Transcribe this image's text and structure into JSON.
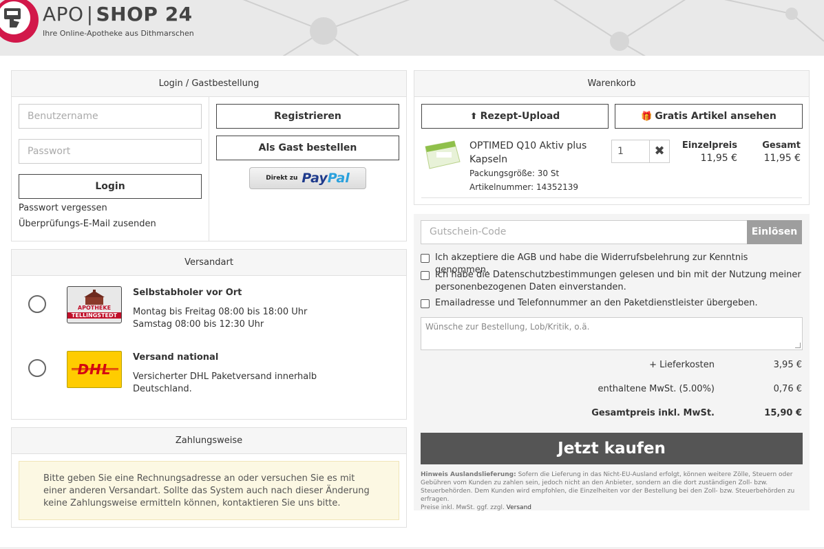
{
  "header": {
    "logo_apo": "APO",
    "logo_sep": "|",
    "logo_shop": "SHOP 24",
    "tagline": "Ihre Online-Apotheke aus Dithmarschen"
  },
  "login": {
    "title": "Login / Gastbestellung",
    "username_placeholder": "Benutzername",
    "password_placeholder": "Passwort",
    "login_button": "Login",
    "forgot_password": "Passwort vergessen",
    "resend_verification": "Überprüfungs-E-Mail zusenden",
    "register_button": "Registrieren",
    "guest_button": "Als Gast bestellen",
    "paypal_prefix": "Direkt zu",
    "paypal_pay": "Pay",
    "paypal_pal": "Pal"
  },
  "shipping": {
    "title": "Versandart",
    "options": [
      {
        "logo_line1": "APOTHEKE",
        "logo_line2": "TELLINGSTEDT",
        "name": "Selbstabholer vor Ort",
        "line1": "Montag bis Freitag 08:00 bis 18:00 Uhr",
        "line2": "Samstag 08:00 bis 12:30 Uhr"
      },
      {
        "logo_text": "DHL",
        "name": "Versand national",
        "line1": "Versicherter DHL Paketversand innerhalb",
        "line2": "Deutschland."
      }
    ]
  },
  "payment": {
    "title": "Zahlungsweise",
    "notice": "Bitte geben Sie eine Rechnungsadresse an oder versuchen Sie es mit einer anderen Versandart. Sollte das System auch nach dieser Änderung keine Zahlungsweise ermitteln können, kontaktieren Sie uns bitte."
  },
  "cart": {
    "title": "Warenkorb",
    "upload_button": "Rezept-Upload",
    "free_items_button": "Gratis Artikel ansehen",
    "item": {
      "name": "OPTIMED Q10 Aktiv plus Kapseln",
      "package_size": "Packungsgröße: 30 St",
      "article_number": "Artikelnummer: 14352139",
      "quantity": "1",
      "unit_price_label": "Einzelpreis",
      "unit_price": "11,95 €",
      "total_label": "Gesamt",
      "total": "11,95 €"
    }
  },
  "checkout": {
    "voucher_placeholder": "Gutschein-Code",
    "voucher_button": "Einlösen",
    "checkboxes": [
      "Ich akzeptiere die AGB und habe die Widerrufsbelehrung zur Kenntnis genommen.",
      "Ich habe die Datenschutzbestimmungen gelesen und bin mit der Nutzung meiner personenbezogenen Daten einverstanden.",
      "Emailadresse und Telefonnummer an den Paketdienstleister übergeben."
    ],
    "comment_placeholder": "Wünsche zur Bestellung, Lob/Kritik, o.ä.",
    "delivery_label": "+ Lieferkosten",
    "delivery_value": "3,95 €",
    "vat_label": "enthaltene MwSt. (5.00%)",
    "vat_value": "0,76 €",
    "total_label": "Gesamtpreis inkl. MwSt.",
    "total_value": "15,90 €",
    "buy_button": "Jetzt kaufen",
    "hint_title": "Hinweis Auslandslieferung:",
    "hint_text": " Sofern die Lieferung in das Nicht-EU-Ausland erfolgt, können weitere Zölle, Steuern oder Gebühren vom Kunden zu zahlen sein, jedoch nicht an den Anbieter, sondern an die dort zuständigen Zoll- bzw. Steuerbehörden. Dem Kunden wird empfohlen, die Einzelheiten vor der Bestellung bei den Zoll- bzw. Steuerbehörden zu erfragen.",
    "prices_note": "Preise  inkl. MwSt.  ggf. zzgl. ",
    "versand_link": "Versand"
  },
  "colors": {
    "brand": "#d2184a",
    "buy_button": "#555555",
    "notice_bg": "#fcf8e3",
    "paypal_dark": "#1f3b8c",
    "paypal_light": "#2aa1dd",
    "dhl_yellow": "#ffcc00",
    "dhl_red": "#d40511"
  }
}
